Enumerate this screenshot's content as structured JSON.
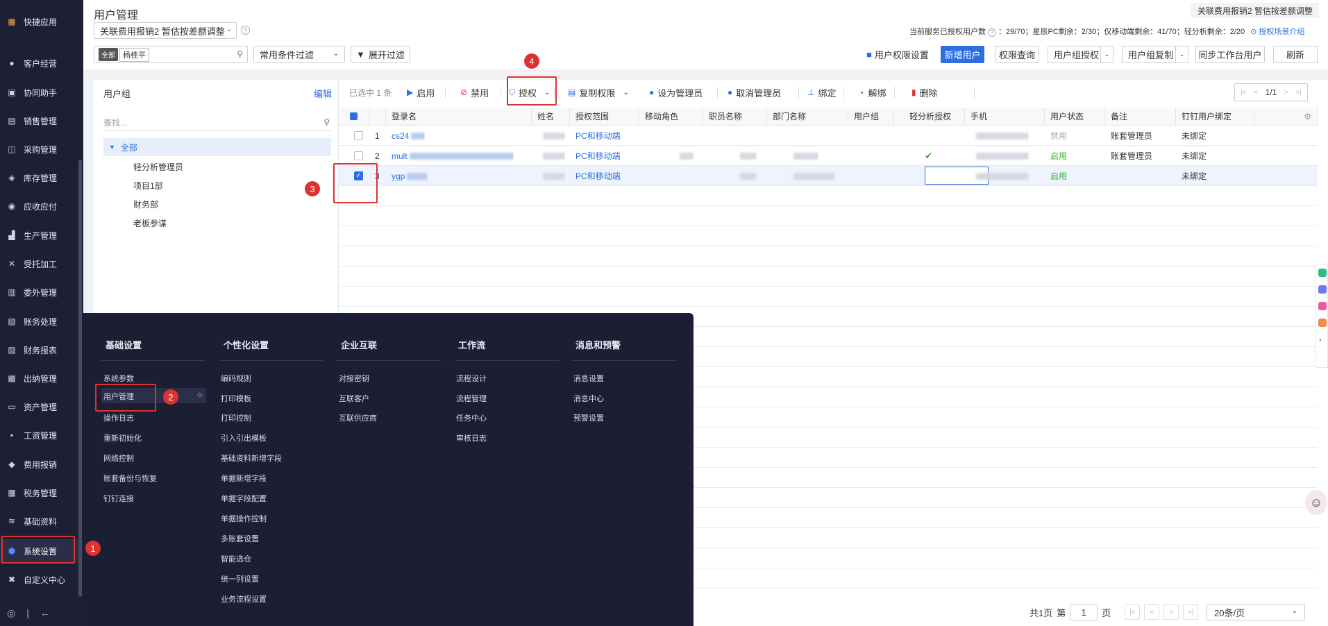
{
  "nav": {
    "items": [
      {
        "label": "快捷应用",
        "icon": "grid-icon"
      },
      {
        "label": "客户经营",
        "icon": "person-icon"
      },
      {
        "label": "协同助手",
        "icon": "contact-icon"
      },
      {
        "label": "销售管理",
        "icon": "chart-icon"
      },
      {
        "label": "采购管理",
        "icon": "cart-icon"
      },
      {
        "label": "库存管理",
        "icon": "box-icon"
      },
      {
        "label": "应收应付",
        "icon": "coin-icon"
      },
      {
        "label": "生产管理",
        "icon": "factory-icon"
      },
      {
        "label": "受托加工",
        "icon": "tools-icon"
      },
      {
        "label": "委外管理",
        "icon": "doc-icon"
      },
      {
        "label": "账务处理",
        "icon": "ledger-icon"
      },
      {
        "label": "财务报表",
        "icon": "report-icon"
      },
      {
        "label": "出纳管理",
        "icon": "cashier-icon"
      },
      {
        "label": "资产管理",
        "icon": "asset-icon"
      },
      {
        "label": "工资管理",
        "icon": "salary-icon"
      },
      {
        "label": "费用报销",
        "icon": "expense-icon"
      },
      {
        "label": "税务管理",
        "icon": "tax-icon"
      },
      {
        "label": "基础资料",
        "icon": "layers-icon"
      },
      {
        "label": "系统设置",
        "icon": "hexagon-gear-icon"
      },
      {
        "label": "自定义中心",
        "icon": "puzzle-icon"
      }
    ]
  },
  "header": {
    "title": "用户管理",
    "book_select": "关联费用报销2 暂估按差额调整",
    "topright_book": "关联费用报销2 暂估按差额调整",
    "license_text": "当前服务已授权用户数",
    "license_detail": "：29/70；星辰PC剩余：2/30；仅移动端剩余：41/70；轻分析剩余：2/20",
    "license_link": "授权场景介绍"
  },
  "filter": {
    "tag_all": "全部",
    "tag_user": "杨桂平",
    "condition": "常用条件过滤",
    "expand": "展开过滤"
  },
  "actions": {
    "user_perm_settings": "用户权限设置",
    "add_user": "新增用户",
    "perm_query": "权限查询",
    "group_auth": "用户组授权",
    "group_copy": "用户组复制",
    "sync_workbench": "同步工作台用户",
    "refresh": "刷新"
  },
  "tree": {
    "title": "用户组",
    "edit": "编辑",
    "search_placeholder": "查找...",
    "root": "全部",
    "children": [
      "轻分析管理员",
      "项目1部",
      "财务部",
      "老板参谋"
    ]
  },
  "toolbar": {
    "selected": "已选中 1 条",
    "enable": "启用",
    "disable": "禁用",
    "authorize": "授权",
    "copy_perm": "复制权限",
    "set_admin": "设为管理员",
    "cancel_admin": "取消管理员",
    "bind": "绑定",
    "unbind": "解绑",
    "delete": "删除",
    "page": "1/1"
  },
  "table": {
    "headers": [
      "登录名",
      "姓名",
      "授权范围",
      "移动角色",
      "职员名称",
      "部门名称",
      "用户组",
      "轻分析授权",
      "手机",
      "用户状态",
      "备注",
      "钉钉用户绑定"
    ],
    "rows": [
      {
        "no": "1",
        "login": "cs24",
        "scope": "PC和移动端",
        "light": "",
        "status": "禁用",
        "note": "账套管理员",
        "ding": "未绑定",
        "checked": false
      },
      {
        "no": "2",
        "login": "mult",
        "scope": "PC和移动端",
        "light": "✔",
        "status": "启用",
        "note": "账套管理员",
        "ding": "未绑定",
        "checked": false
      },
      {
        "no": "3",
        "login": "ygp",
        "scope": "PC和移动端",
        "light": "",
        "status": "启用",
        "note": "",
        "ding": "未绑定",
        "checked": true
      }
    ]
  },
  "pager": {
    "total": "共1页",
    "di": "第",
    "page": "1",
    "ye": "页",
    "size": "20条/页"
  },
  "settings_menu": {
    "columns": [
      {
        "title": "基础设置",
        "items": [
          "系统参数",
          "用户管理",
          "操作日志",
          "重新初始化",
          "网络控制",
          "账套备份与恢复",
          "钉钉连接"
        ]
      },
      {
        "title": "个性化设置",
        "items": [
          "编码规则",
          "打印模板",
          "打印控制",
          "引入引出模板",
          "基础资料新增字段",
          "单据新增字段",
          "单据字段配置",
          "单据操作控制",
          "多账套设置",
          "智能选仓",
          "统一列设置",
          "业务流程设置"
        ]
      },
      {
        "title": "企业互联",
        "items": [
          "对接密钥",
          "互联客户",
          "互联供应商"
        ]
      },
      {
        "title": "工作流",
        "items": [
          "流程设计",
          "流程管理",
          "任务中心",
          "审核日志"
        ]
      },
      {
        "title": "消息和预警",
        "items": [
          "消息设置",
          "消息中心",
          "预警设置"
        ]
      }
    ]
  },
  "annotations": {
    "b1": "1",
    "b2": "2",
    "b3": "3",
    "b4": "4"
  },
  "colors": {
    "accent": "#2d6fe0",
    "nav_bg": "#1d2035",
    "menu_bg": "#1c1e34",
    "annotation": "#e03131",
    "enabled": "#47b03a"
  }
}
